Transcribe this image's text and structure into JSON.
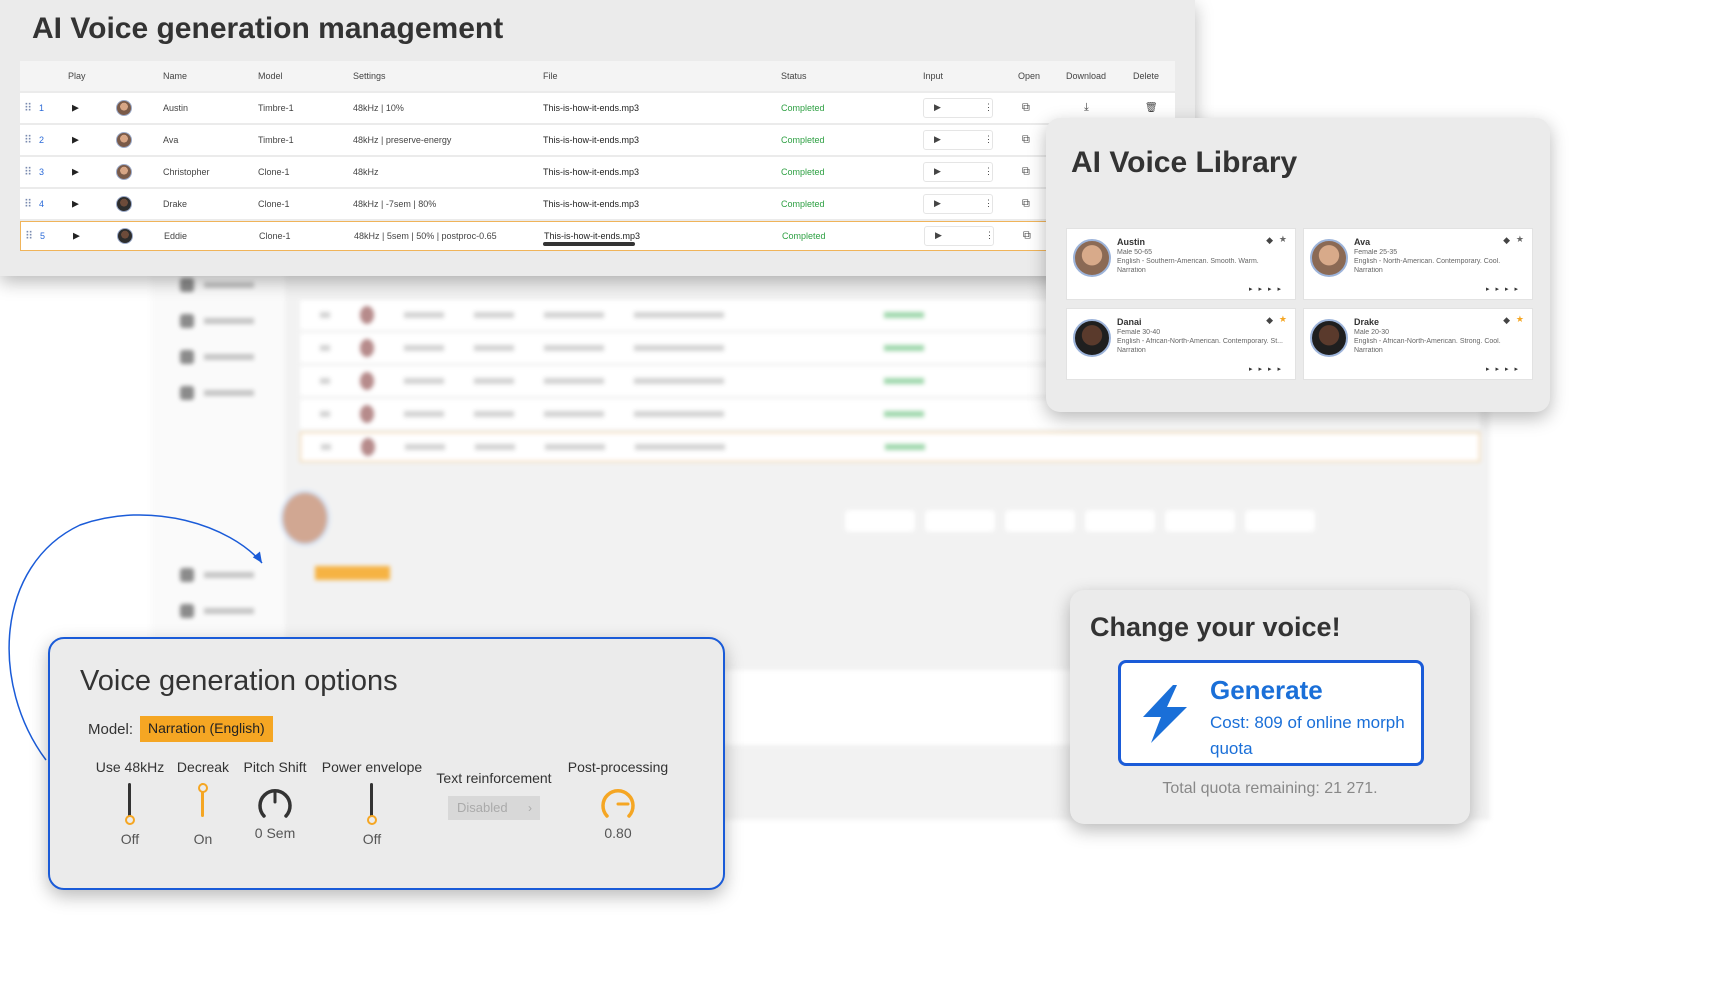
{
  "management": {
    "title": "AI Voice generation management",
    "columns": [
      "Play",
      "Name",
      "Model",
      "Settings",
      "File",
      "Status",
      "Input",
      "Open",
      "Download",
      "Delete"
    ],
    "rows": [
      {
        "num": "1",
        "name": "Austin",
        "model": "Timbre-1",
        "settings": "48kHz | 10%",
        "file": "This-is-how-it-ends.mp3",
        "status": "Completed"
      },
      {
        "num": "2",
        "name": "Ava",
        "model": "Timbre-1",
        "settings": "48kHz | preserve-energy",
        "file": "This-is-how-it-ends.mp3",
        "status": "Completed"
      },
      {
        "num": "3",
        "name": "Christopher",
        "model": "Clone-1",
        "settings": "48kHz",
        "file": "This-is-how-it-ends.mp3",
        "status": "Completed"
      },
      {
        "num": "4",
        "name": "Drake",
        "model": "Clone-1",
        "settings": "48kHz | -7sem | 80%",
        "file": "This-is-how-it-ends.mp3",
        "status": "Completed"
      },
      {
        "num": "5",
        "name": "Eddie",
        "model": "Clone-1",
        "settings": "48kHz | 5sem | 50% | postproc-0.65",
        "file": "This-is-how-it-ends.mp3",
        "status": "Completed"
      }
    ],
    "selected_row": "5",
    "status_color": "#2ea043"
  },
  "library": {
    "title": "AI Voice Library",
    "voices": [
      {
        "name": "Austin",
        "line1": "Male 50-65",
        "line2": "English - Southern-American. Smooth. Warm.",
        "line3": "Narration",
        "starred": false
      },
      {
        "name": "Ava",
        "line1": "Female 25-35",
        "line2": "English - North-American. Contemporary. Cool.",
        "line3": "Narration",
        "starred": false
      },
      {
        "name": "Danai",
        "line1": "Female 30-40",
        "line2": "English - African-North-American. Contemporary. St...",
        "line3": "Narration",
        "starred": true
      },
      {
        "name": "Drake",
        "line1": "Male 20-30",
        "line2": "English - African-North-American. Strong. Cool.",
        "line3": "Narration",
        "starred": true
      }
    ]
  },
  "options": {
    "title": "Voice generation options",
    "model_label": "Model:",
    "model_value": "Narration (English)",
    "controls": {
      "use48": {
        "label": "Use 48kHz",
        "value": "Off"
      },
      "decreak": {
        "label": "Decreak",
        "value": "On"
      },
      "pitch": {
        "label": "Pitch Shift",
        "value": "0 Sem"
      },
      "power": {
        "label": "Power envelope",
        "value": "Off"
      },
      "textreinf": {
        "label": "Text reinforcement",
        "value": "Disabled"
      },
      "postproc": {
        "label": "Post-processing",
        "value": "0.80"
      }
    },
    "accent_color": "#f5a623"
  },
  "change": {
    "title": "Change your voice!",
    "generate_label": "Generate",
    "cost_label": "Cost: 809 of online morph quota",
    "quota_label": "Total quota remaining: 21 271.",
    "accent_color": "#1a6fd8"
  }
}
